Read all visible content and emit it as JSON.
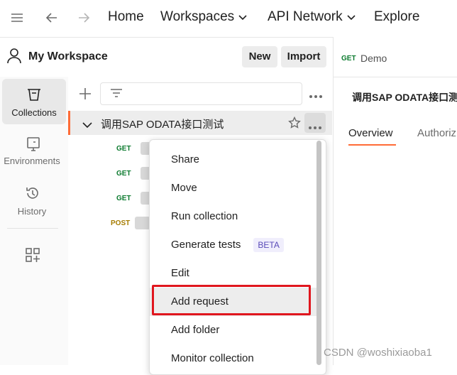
{
  "topnav": {
    "home": "Home",
    "workspaces": "Workspaces",
    "api_network": "API Network",
    "explore": "Explore"
  },
  "workspace": {
    "title": "My Workspace",
    "new_label": "New",
    "import_label": "Import"
  },
  "rail": {
    "items": [
      {
        "label": "Collections",
        "icon": "collections-icon",
        "active": true
      },
      {
        "label": "Environments",
        "icon": "environments-icon",
        "active": false
      },
      {
        "label": "History",
        "icon": "history-icon",
        "active": false
      }
    ]
  },
  "tree": {
    "collection_name": "调用SAP ODATA接口测试",
    "requests": [
      {
        "method": "GET",
        "color": "#0b7a2e"
      },
      {
        "method": "GET",
        "color": "#0b7a2e"
      },
      {
        "method": "GET",
        "color": "#0b7a2e"
      },
      {
        "method": "POST",
        "color": "#a67c00"
      }
    ]
  },
  "right": {
    "tab_method": "GET",
    "tab_name": "Demo",
    "title": "调用SAP ODATA接口测",
    "tabs": [
      "Overview",
      "Authoriz"
    ]
  },
  "menu": {
    "items": [
      "Share",
      "Move",
      "Run collection",
      "Generate tests",
      "Edit",
      "Add request",
      "Add folder",
      "Monitor collection"
    ],
    "beta_label": "BETA",
    "highlighted": "Add request"
  },
  "watermark": "CSDN @woshixiaoba1",
  "colors": {
    "accent": "#ff6c37",
    "highlight_box": "#e0161e",
    "get": "#0b7a2e",
    "post": "#a67c00"
  }
}
